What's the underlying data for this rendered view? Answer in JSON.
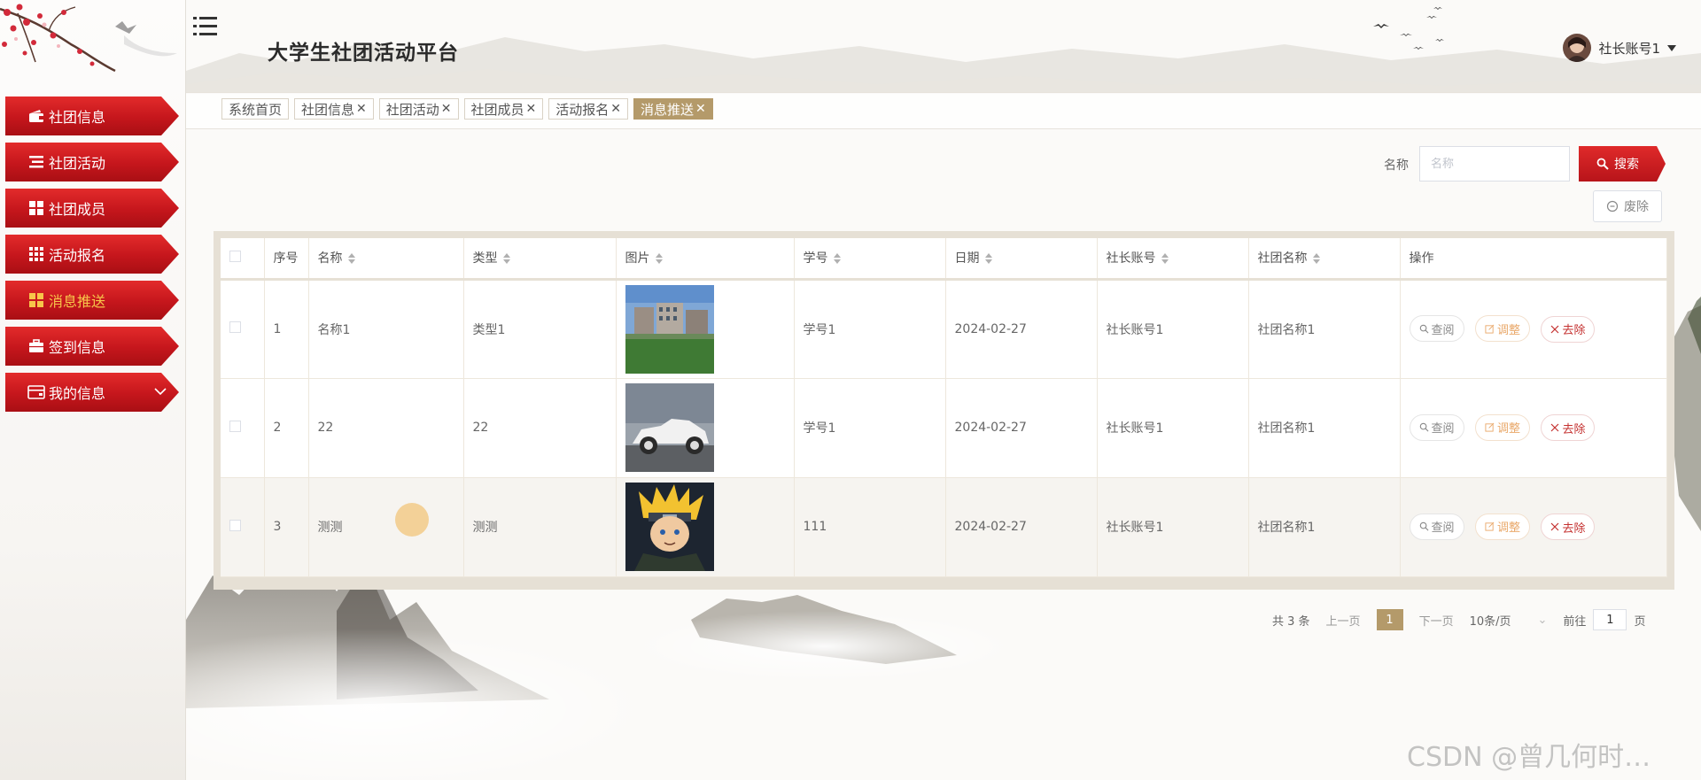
{
  "app": {
    "title": "大学生社团活动平台"
  },
  "user": {
    "name": "社长账号1"
  },
  "sidebar": {
    "items": [
      {
        "label": "社团信息",
        "icon": "wallet-icon"
      },
      {
        "label": "社团活动",
        "icon": "list-icon"
      },
      {
        "label": "社团成员",
        "icon": "grid-icon"
      },
      {
        "label": "活动报名",
        "icon": "apps-icon"
      },
      {
        "label": "消息推送",
        "icon": "grid-icon",
        "active": true
      },
      {
        "label": "签到信息",
        "icon": "briefcase-icon"
      },
      {
        "label": "我的信息",
        "icon": "card-icon",
        "expandable": true
      }
    ]
  },
  "tabs": [
    {
      "label": "系统首页",
      "closable": false
    },
    {
      "label": "社团信息",
      "closable": true
    },
    {
      "label": "社团活动",
      "closable": true
    },
    {
      "label": "社团成员",
      "closable": true
    },
    {
      "label": "活动报名",
      "closable": true
    },
    {
      "label": "消息推送",
      "closable": true,
      "active": true
    }
  ],
  "tab_close_glyph": "✕",
  "search": {
    "label": "名称",
    "placeholder": "名称",
    "value": "",
    "button": "搜索"
  },
  "toolbar": {
    "delete_label": "废除"
  },
  "table": {
    "columns": [
      "序号",
      "名称",
      "类型",
      "图片",
      "学号",
      "日期",
      "社长账号",
      "社团名称",
      "操作"
    ],
    "rows": [
      {
        "index": "1",
        "name": "名称1",
        "type": "类型1",
        "image": "building-photo",
        "student_no": "学号1",
        "date": "2024-02-27",
        "leader": "社长账号1",
        "club": "社团名称1"
      },
      {
        "index": "2",
        "name": "22",
        "type": "22",
        "image": "car-photo",
        "student_no": "学号1",
        "date": "2024-02-27",
        "leader": "社长账号1",
        "club": "社团名称1"
      },
      {
        "index": "3",
        "name": "测测",
        "type": "测测",
        "image": "anime-character-photo",
        "student_no": "111",
        "date": "2024-02-27",
        "leader": "社长账号1",
        "club": "社团名称1"
      }
    ],
    "actions": {
      "view": "查阅",
      "edit": "调整",
      "delete": "去除"
    }
  },
  "pagination": {
    "total_text": "共 3 条",
    "prev": "上一页",
    "current_page": "1",
    "next": "下一页",
    "page_size": "10条/页",
    "goto_label": "前往",
    "goto_value": "1",
    "page_unit": "页"
  },
  "watermark": "CSDN @曾几何时…",
  "colors": {
    "menu_red": "#c5161c",
    "accent_tan": "#b49a6a",
    "active_menu_text": "#f7c64a"
  }
}
